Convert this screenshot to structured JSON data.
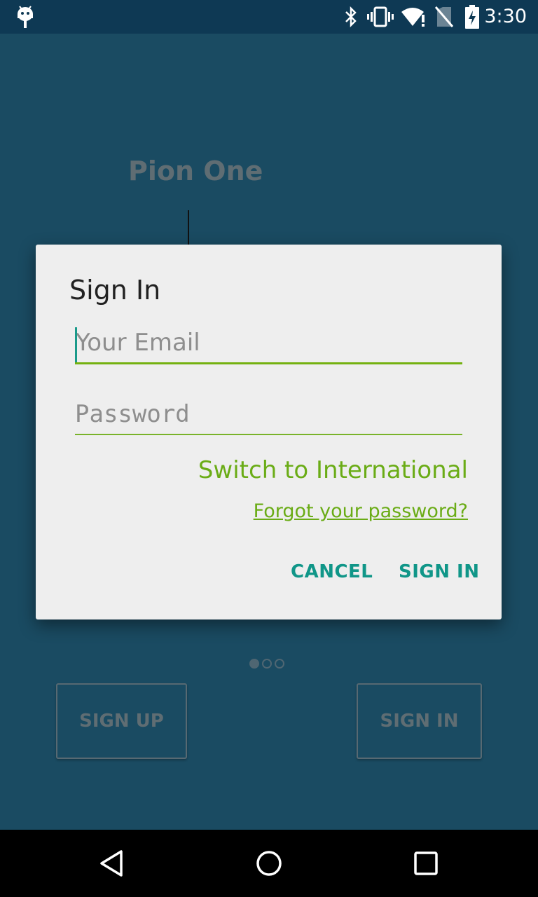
{
  "status_bar": {
    "time": "3:30",
    "icons": [
      "android-icon",
      "bluetooth-icon",
      "vibrate-icon",
      "wifi-icon",
      "no-sim-icon",
      "battery-charging-icon"
    ]
  },
  "background": {
    "app_title": "Pion One",
    "page_indicator": {
      "count": 3,
      "active": 0
    },
    "sign_up_label": "SIGN UP",
    "sign_in_label": "SIGN IN"
  },
  "dialog": {
    "title": "Sign In",
    "email_placeholder": "Your Email",
    "password_placeholder": "Password",
    "switch_label": "Switch to International",
    "forgot_label": "Forgot your password?",
    "cancel_label": "CANCEL",
    "sign_in_label": "SIGN IN"
  },
  "colors": {
    "accent_green": "#6aac16",
    "accent_teal": "#109688",
    "background": "#184a61"
  }
}
